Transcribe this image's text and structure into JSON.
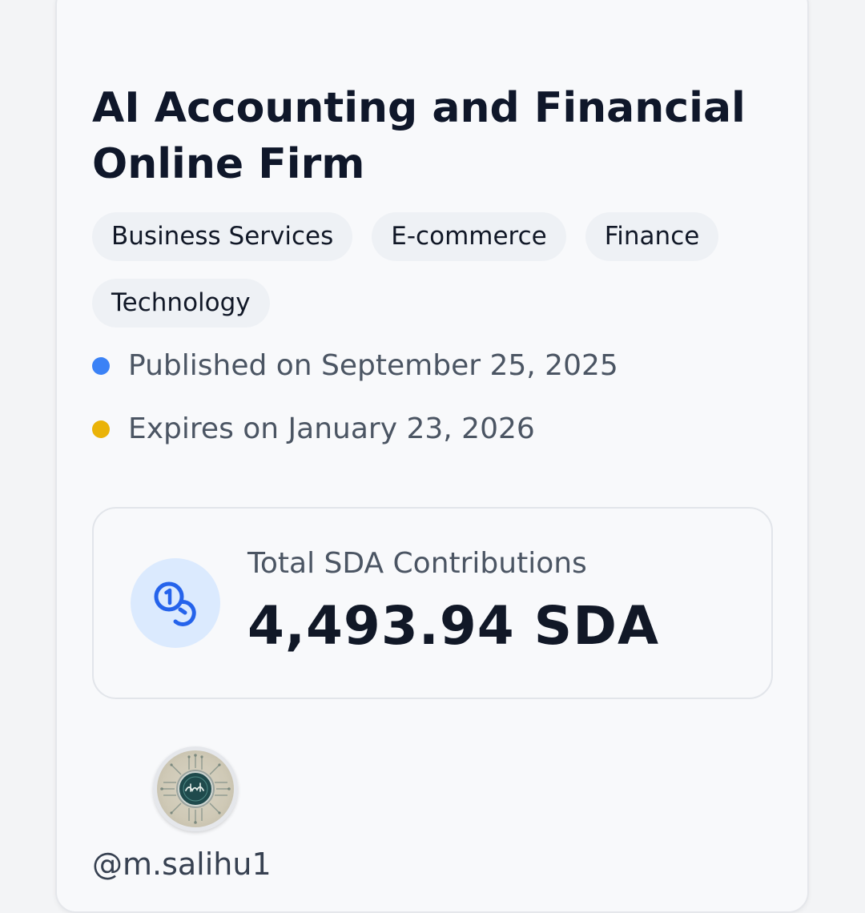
{
  "listing": {
    "title": "AI Accounting and Financial Online Firm",
    "tags": [
      "Business Services",
      "E-commerce",
      "Finance",
      "Technology"
    ],
    "published": "Published on September 25, 2025",
    "expires": "Expires on January 23, 2026"
  },
  "contributions": {
    "label": "Total SDA Contributions",
    "value": "4,493.94 SDA",
    "icon": "coins-icon"
  },
  "owner": {
    "avatar_icon": "avatar-image",
    "username": "@m.salihu1"
  },
  "colors": {
    "published_dot": "#3b82f6",
    "expires_dot": "#eab308",
    "icon_accent": "#2563eb",
    "icon_background": "#dbeafe"
  }
}
